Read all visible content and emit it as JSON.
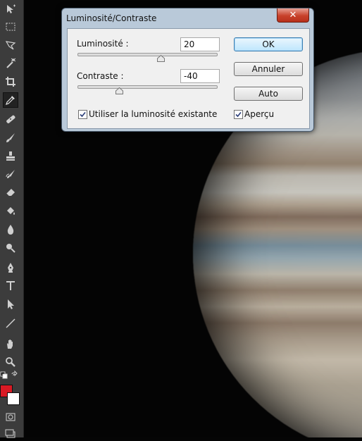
{
  "dialog": {
    "title": "Luminosité/Contraste",
    "close_label": "✕",
    "brightness": {
      "label": "Luminosité :",
      "value": "20",
      "slider_fraction": 0.6
    },
    "contrast": {
      "label": "Contraste :",
      "value": "-40",
      "slider_fraction": 0.3
    },
    "buttons": {
      "ok": "OK",
      "cancel": "Annuler",
      "auto": "Auto"
    },
    "use_legacy": {
      "label": "Utiliser la luminosité existante",
      "checked": true
    },
    "preview": {
      "label": "Aperçu",
      "checked": true
    }
  },
  "toolbar": {
    "tools": [
      "move-icon",
      "marquee-icon",
      "lasso-icon",
      "magic-wand-icon",
      "crop-icon",
      "eyedropper-icon",
      "healing-brush-icon",
      "brush-icon",
      "clone-stamp-icon",
      "history-brush-icon",
      "eraser-icon",
      "paint-bucket-icon",
      "blur-icon",
      "dodge-icon",
      "pen-icon",
      "type-icon",
      "path-selection-icon",
      "line-icon",
      "hand-icon",
      "zoom-icon"
    ],
    "active_tool": "eyedropper-icon",
    "foreground_color": "#d91a24",
    "background_color": "#ffffff"
  }
}
